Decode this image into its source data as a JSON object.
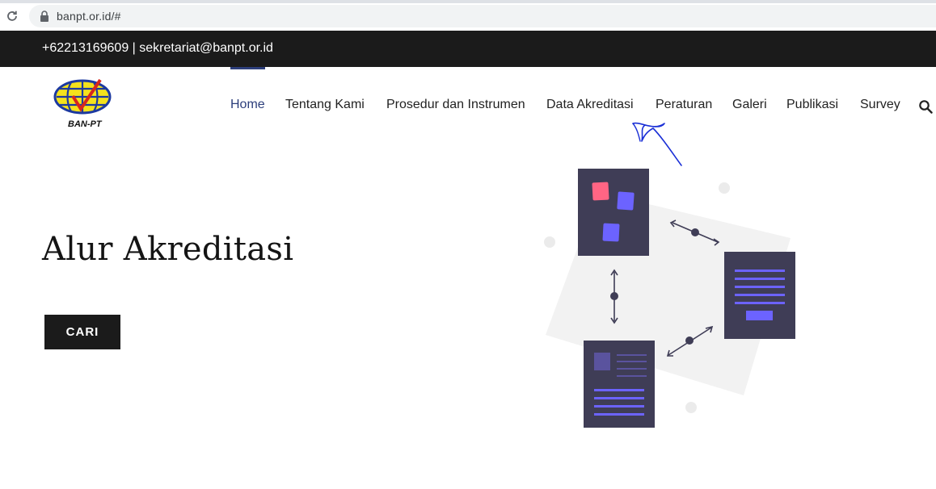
{
  "browser": {
    "url": "banpt.or.id/#"
  },
  "topbar": {
    "contact": "+62213169609 | sekretariat@banpt.or.id"
  },
  "logo": {
    "text": "BAN-PT"
  },
  "nav": {
    "items": [
      {
        "label": "Home",
        "active": true
      },
      {
        "label": "Tentang Kami",
        "active": false
      },
      {
        "label": "Prosedur dan Instrumen",
        "active": false
      },
      {
        "label": "Data Akreditasi",
        "active": false
      },
      {
        "label": "Peraturan",
        "active": false
      },
      {
        "label": "Galeri",
        "active": false
      },
      {
        "label": "Publikasi",
        "active": false
      },
      {
        "label": "Survey",
        "active": false
      }
    ],
    "search_icon": "search-icon"
  },
  "hero": {
    "title": "Alur Akreditasi",
    "button_label": "CARI"
  },
  "colors": {
    "topbar": "#1b1b1b",
    "nav_active": "#2c3e7b",
    "doc_dark": "#3f3d56",
    "accent_purple": "#6c63ff",
    "accent_red": "#ff6584",
    "bg_shape": "#f2f2f2",
    "scribble": "#1a2fd6"
  }
}
